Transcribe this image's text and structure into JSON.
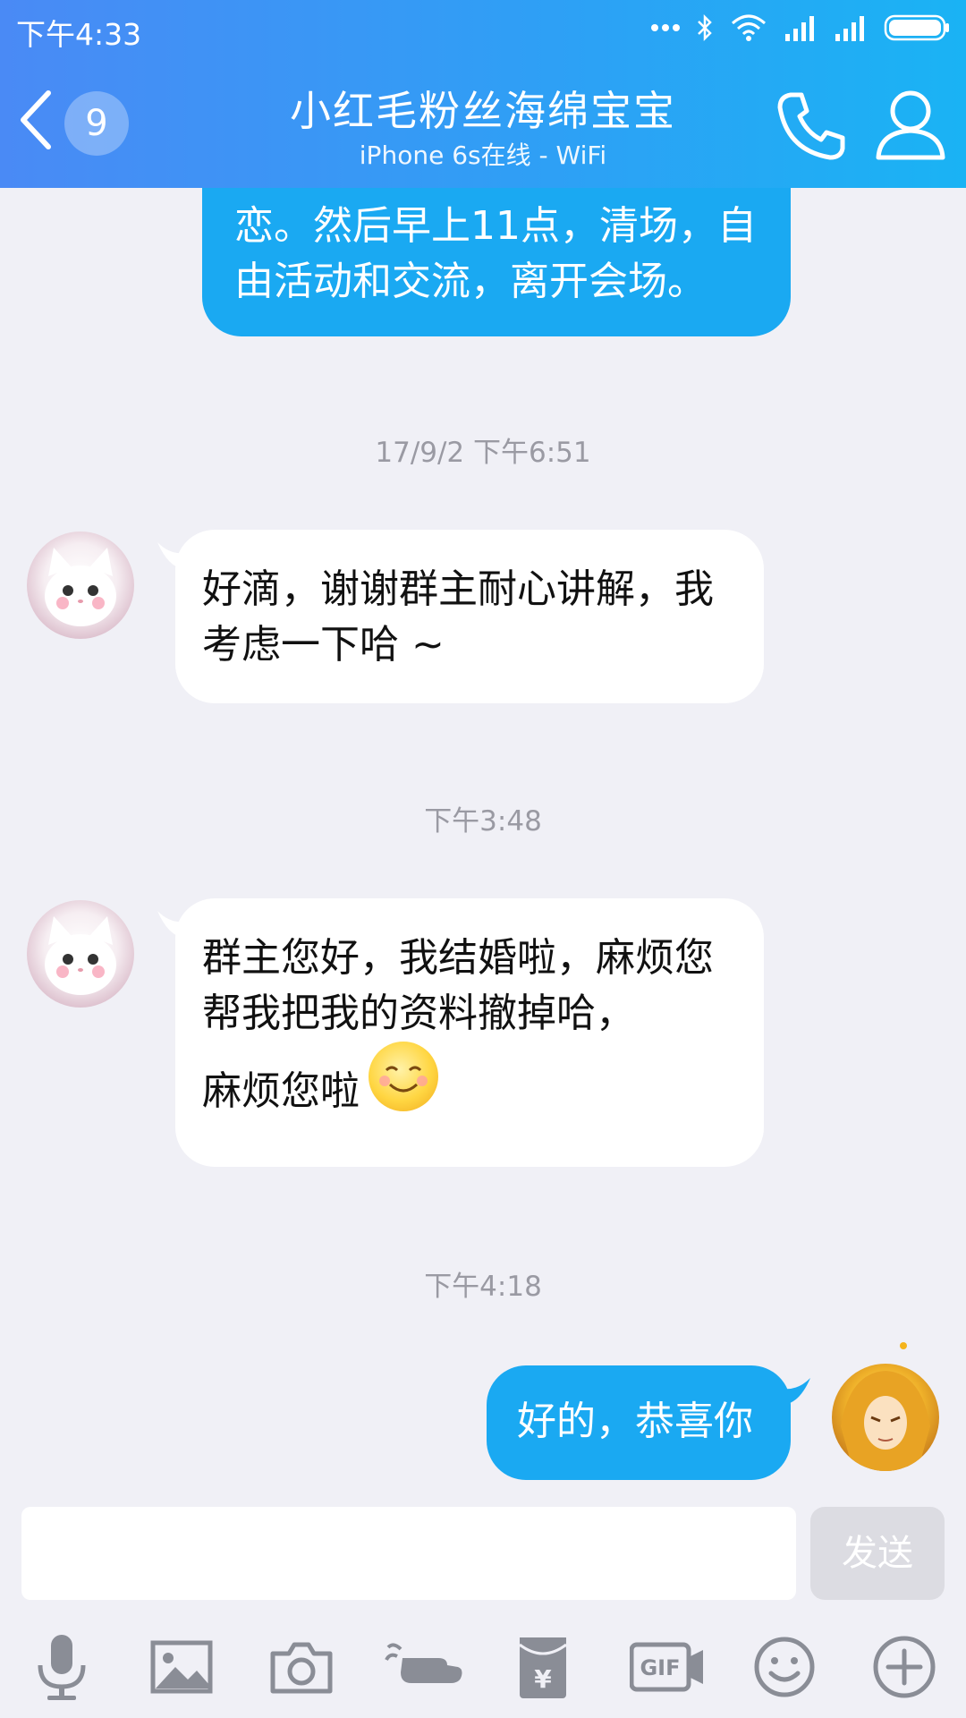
{
  "status_bar": {
    "time": "下午4:33"
  },
  "header": {
    "back_badge": "9",
    "title": "小红毛粉丝海绵宝宝",
    "subtitle": "iPhone 6s在线 - WiFi"
  },
  "messages": [
    {
      "direction": "out",
      "text": "恋。然后早上11点，清场，自由活动和交流，离开会场。"
    },
    {
      "type": "timestamp",
      "text": "17/9/2 下午6:51"
    },
    {
      "direction": "in",
      "text": "好滴，谢谢群主耐心讲解，我考虑一下哈 ~"
    },
    {
      "type": "timestamp",
      "text": "下午3:48"
    },
    {
      "direction": "in",
      "text": "群主您好，我结婚啦，麻烦您帮我把我的资料撤掉哈，",
      "text_tail": "麻烦您啦"
    },
    {
      "type": "timestamp",
      "text": "下午4:18"
    },
    {
      "direction": "out",
      "text": "好的，恭喜你"
    }
  ],
  "input": {
    "value": "",
    "placeholder": "",
    "send_label": "发送"
  },
  "toolbar": {
    "items": [
      "microphone-icon",
      "image-icon",
      "camera-icon",
      "hand-icon",
      "red-packet-icon",
      "gif-icon",
      "emoji-icon",
      "plus-icon"
    ],
    "gif_label": "GIF",
    "yen_label": "¥"
  },
  "colors": {
    "header_start": "#4a8af5",
    "header_end": "#1ab3f4",
    "outgoing_bubble": "#1aa9f2",
    "incoming_bubble": "#ffffff",
    "background": "#f0f0f6"
  }
}
